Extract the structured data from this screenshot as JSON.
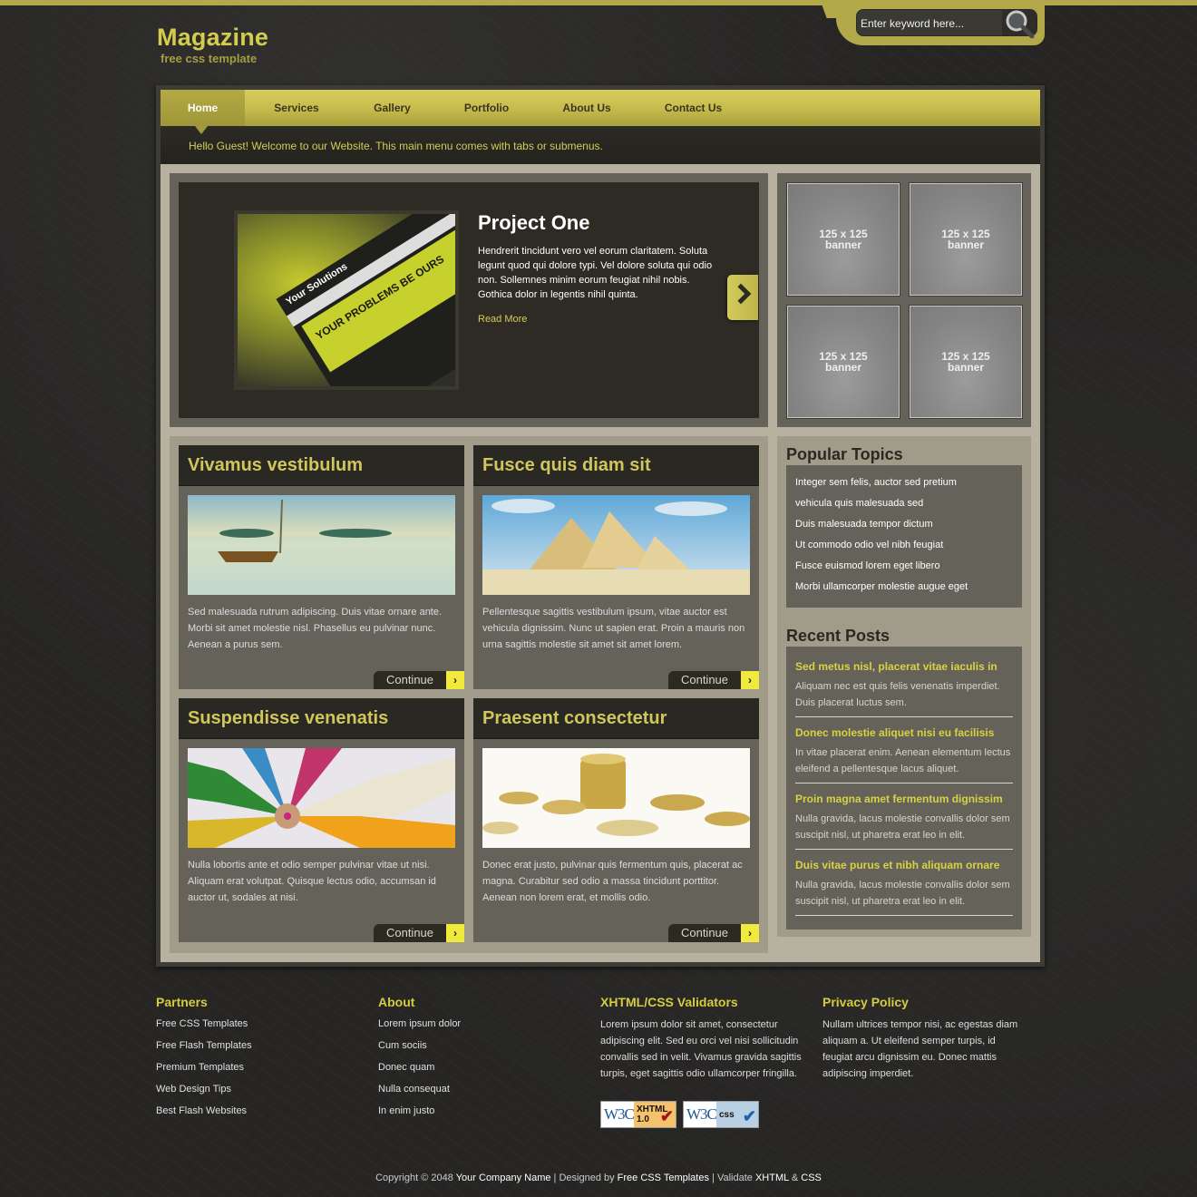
{
  "header": {
    "logo_title": "Magazine",
    "logo_subtitle": "free css template",
    "search": {
      "placeholder": "Enter keyword here...",
      "value": ""
    }
  },
  "nav": {
    "items": [
      {
        "label": "Home",
        "active": true
      },
      {
        "label": "Services"
      },
      {
        "label": "Gallery"
      },
      {
        "label": "Portfolio"
      },
      {
        "label": "About Us"
      },
      {
        "label": "Contact Us"
      }
    ],
    "welcome": "Hello Guest! Welcome to our Website. This main menu comes with tabs or submenus."
  },
  "featured": {
    "image_caption_1": "Your Solutions",
    "image_caption_2": "YOUR PROBLEMS BE OURS",
    "title": "Project One",
    "text": "Hendrerit tincidunt vero vel eorum claritatem. Soluta legunt quod qui dolore typi. Vel dolore soluta qui odio non. Sollemnes minim eorum feugiat nihil nobis. Gothica dolor in legentis nihil quinta.",
    "read_more": "Read More"
  },
  "banners": [
    {
      "line1": "125 x 125",
      "line2": "banner"
    },
    {
      "line1": "125 x 125",
      "line2": "banner"
    },
    {
      "line1": "125 x 125",
      "line2": "banner"
    },
    {
      "line1": "125 x 125",
      "line2": "banner"
    }
  ],
  "posts": [
    {
      "title": "Vivamus vestibulum",
      "image": "sailboat-on-calm-sea",
      "text": "Sed malesuada rutrum adipiscing. Duis vitae ornare ante. Morbi sit amet molestie nisl. Phasellus eu pulvinar nunc. Aenean a purus sem.",
      "continue": "Continue"
    },
    {
      "title": "Fusce quis diam sit",
      "image": "pyramids-of-giza",
      "text": "Pellentesque sagittis vestibulum ipsum, vitae auctor est vehicula dignissim. Nunc ut sapien erat. Proin a mauris non urna sagittis molestie sit amet sit amet lorem.",
      "continue": "Continue"
    },
    {
      "title": "Suspendisse venenatis",
      "image": "colored-pencils",
      "text": "Nulla lobortis ante et odio semper pulvinar vitae ut nisi. Aliquam erat volutpat. Quisque lectus odio, accumsan id auctor ut, sodales at nisi.",
      "continue": "Continue"
    },
    {
      "title": "Praesent consectetur",
      "image": "gold-coins",
      "text": "Donec erat justo, pulvinar quis fermentum quis, placerat ac magna. Curabitur sed odio a massa tincidunt porttitor. Aenean non lorem erat, et mollis odio.",
      "continue": "Continue"
    }
  ],
  "sidebar": {
    "popular_title": "Popular Topics",
    "popular": [
      "Integer sem felis, auctor sed pretium",
      "vehicula quis malesuada sed",
      "Duis malesuada tempor dictum",
      "Ut commodo odio vel nibh feugiat",
      "Fusce euismod lorem eget libero",
      "Morbi ullamcorper molestie augue eget"
    ],
    "recent_title": "Recent Posts",
    "recent": [
      {
        "title": "Sed metus nisl, placerat vitae iaculis in",
        "text": "Aliquam nec est quis felis venenatis imperdiet. Duis placerat luctus sem."
      },
      {
        "title": "Donec molestie aliquet nisi eu facilisis",
        "text": "In vitae placerat enim. Aenean elementum lectus eleifend a pellentesque lacus aliquet."
      },
      {
        "title": "Proin magna amet fermentum dignissim",
        "text": "Nulla gravida, lacus molestie convallis dolor sem suscipit nisl, ut pharetra erat leo in elit."
      },
      {
        "title": "Duis vitae purus et nibh aliquam ornare",
        "text": "Nulla gravida, lacus molestie convallis dolor sem suscipit nisl, ut pharetra erat leo in elit."
      }
    ]
  },
  "footer": {
    "partners": {
      "title": "Partners",
      "links": [
        "Free CSS Templates",
        "Free Flash Templates",
        "Premium Templates",
        "Web Design Tips",
        "Best Flash Websites"
      ]
    },
    "about": {
      "title": "About",
      "links": [
        "Lorem ipsum dolor",
        "Cum sociis",
        "Donec quam",
        "Nulla consequat",
        "In enim justo"
      ]
    },
    "validators": {
      "title": "XHTML/CSS Validators",
      "text": "Lorem ipsum dolor sit amet, consectetur adipiscing elit. Sed eu orci vel nisi sollicitudin convallis sed in velit. Vivamus gravida sagittis turpis, eget sagittis odio ullamcorper fringilla.",
      "badges": [
        {
          "logo": "W3C",
          "label": "XHTML 1.0",
          "line1": "XHTML",
          "line2": "1.0",
          "color": "#f5c26b",
          "check_color": "#a3141b"
        },
        {
          "logo": "W3C",
          "label": "CSS",
          "line1": "css",
          "line2": "",
          "color": "#b8cfe4",
          "check_color": "#1b64a8"
        }
      ]
    },
    "privacy": {
      "title": "Privacy Policy",
      "text": "Nullam ultrices tempor nisi, ac egestas diam aliquam a. Ut eleifend semper turpis, id feugiat arcu dignissim eu. Donec mattis adipiscing imperdiet."
    },
    "copyright": {
      "prefix": "Copyright © 2048 ",
      "company": "Your Company Name",
      "sep1": " | Designed by ",
      "designer": "Free CSS Templates",
      "sep2": " | Validate ",
      "xhtml": "XHTML",
      "amp": " & ",
      "css": "CSS"
    }
  },
  "colors": {
    "accent": "#d4cc4c",
    "nav_bar": "#c7bd4e",
    "content_bg": "#b7b19f",
    "panel": "#65625a",
    "dark": "#2d2b24"
  }
}
